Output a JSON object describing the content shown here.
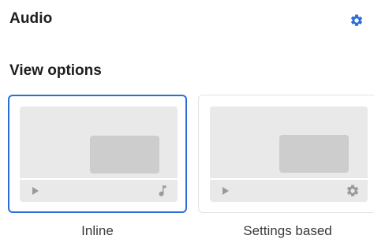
{
  "header": {
    "title": "Audio",
    "settings_icon": "gear-icon",
    "accent_color": "#2b6fd6"
  },
  "view_options": {
    "title": "View options",
    "options": [
      {
        "label": "Inline",
        "selected": true,
        "control_icons": [
          "play-icon",
          "music-note-icon"
        ]
      },
      {
        "label": "Settings based",
        "selected": false,
        "control_icons": [
          "play-icon",
          "gear-icon"
        ]
      }
    ]
  }
}
